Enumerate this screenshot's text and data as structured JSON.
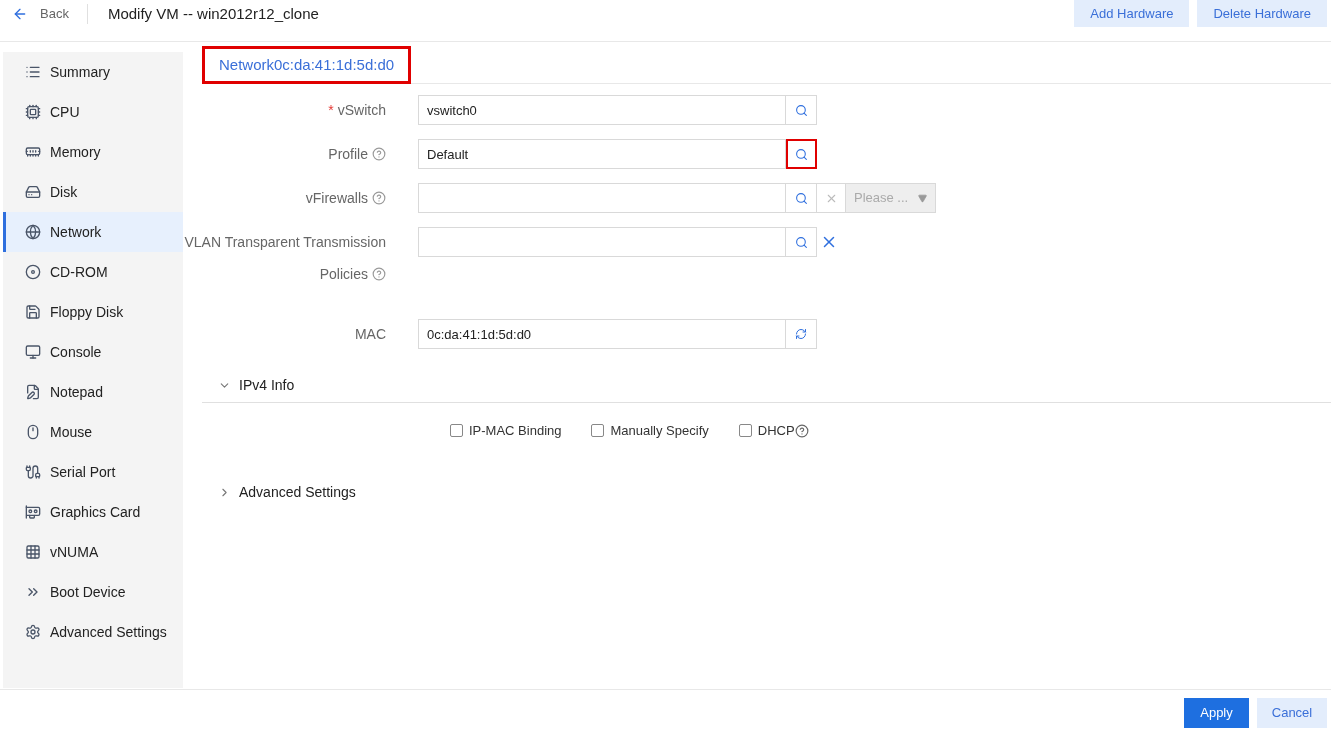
{
  "header": {
    "back": "Back",
    "title": "Modify VM -- win2012r12_clone",
    "actions": [
      "Add Hardware",
      "Delete Hardware"
    ]
  },
  "sidebar": {
    "items": [
      {
        "label": "Summary",
        "selected": false
      },
      {
        "label": "CPU",
        "selected": false
      },
      {
        "label": "Memory",
        "selected": false
      },
      {
        "label": "Disk",
        "selected": false
      },
      {
        "label": "Network",
        "selected": true
      },
      {
        "label": "CD-ROM",
        "selected": false
      },
      {
        "label": "Floppy Disk",
        "selected": false
      },
      {
        "label": "Console",
        "selected": false
      },
      {
        "label": "Notepad",
        "selected": false
      },
      {
        "label": "Mouse",
        "selected": false
      },
      {
        "label": "Serial Port",
        "selected": false
      },
      {
        "label": "Graphics Card",
        "selected": false
      },
      {
        "label": "vNUMA",
        "selected": false
      },
      {
        "label": "Boot Device",
        "selected": false
      },
      {
        "label": "Advanced Settings",
        "selected": false
      }
    ]
  },
  "tab": {
    "label": "Network0c:da:41:1d:5d:d0",
    "highlighted": true
  },
  "form": [
    {
      "kind": "search",
      "required_mark": "*",
      "label": "vSwitch",
      "value": "vswitch0",
      "button_highlighted": false
    },
    {
      "kind": "search",
      "label": "Profile",
      "help": true,
      "value": "Default",
      "button_highlighted": true
    },
    {
      "kind": "search_clear_select",
      "label": "vFirewalls",
      "help": true,
      "select_placeholder": "Please ...",
      "button_highlighted": false
    },
    {
      "kind": "search_clear",
      "label": "VLAN Transparent Transmission",
      "label_2": "Policies",
      "help": true,
      "button_highlighted": false
    },
    {
      "kind": "refresh",
      "label": "MAC",
      "value": "0c:da:41:1d:5d:d0"
    }
  ],
  "ipv4": {
    "title": "IPv4 Info",
    "expanded": true,
    "options": [
      {
        "label": "IP-MAC Binding",
        "checked": false
      },
      {
        "label": "Manually Specify",
        "checked": false
      },
      {
        "label": "DHCP",
        "checked": false,
        "help": true
      }
    ]
  },
  "advanced": {
    "title": "Advanced Settings",
    "expanded": false
  },
  "footer": {
    "apply": "Apply",
    "cancel": "Cancel"
  }
}
